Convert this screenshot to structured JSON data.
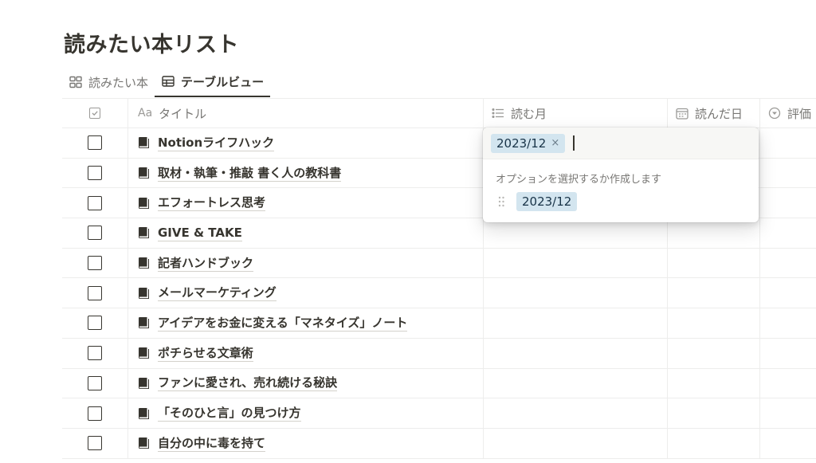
{
  "page": {
    "title": "読みたい本リスト"
  },
  "tabs": [
    {
      "label": "読みたい本",
      "icon": "gallery-icon",
      "active": false
    },
    {
      "label": "テーブルビュー",
      "icon": "table-icon",
      "active": true
    }
  ],
  "columns": {
    "check": {
      "icon": "checkbox-icon"
    },
    "title": {
      "prefix": "Aa",
      "label": "タイトル"
    },
    "month": {
      "label": "読む月",
      "icon": "list-icon"
    },
    "date": {
      "label": "読んだ日",
      "icon": "calendar-icon"
    },
    "rating": {
      "label": "評価",
      "icon": "select-icon"
    }
  },
  "rows": [
    {
      "title": "Notionライフハック"
    },
    {
      "title": "取材・執筆・推敲 書く人の教科書"
    },
    {
      "title": "エフォートレス思考"
    },
    {
      "title": "GIVE & TAKE"
    },
    {
      "title": "記者ハンドブック"
    },
    {
      "title": "メールマーケティング"
    },
    {
      "title": "アイデアをお金に変える「マネタイズ」ノート"
    },
    {
      "title": "ポチらせる文章術"
    },
    {
      "title": "ファンに愛され、売れ続ける秘訣"
    },
    {
      "title": "「そのひと言」の見つけ方"
    },
    {
      "title": "自分の中に毒を持て"
    }
  ],
  "popup": {
    "selected_tag": "2023/12",
    "remove_symbol": "×",
    "hint": "オプションを選択するか作成します",
    "option": "2023/12"
  },
  "colors": {
    "tag_bg": "#d3e5ef",
    "text": "#37352f",
    "muted": "#787774"
  }
}
